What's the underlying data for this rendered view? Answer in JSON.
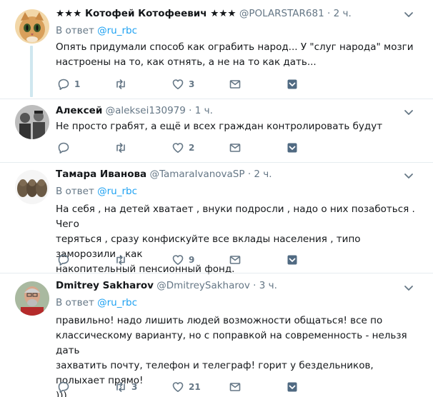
{
  "tweets": [
    {
      "name": "★★★ Котофей Котофеевич ★★★",
      "handle": "@POLARSTAR681",
      "time": "· 2 ч.",
      "reply_label": "В ответ",
      "reply_handle": "@ru_rbc",
      "text": "Опять придумали способ как ограбить народ... У \"слуг народа\" мозги\nнастроены на то, как отнять, а не на то как дать...",
      "replies": "1",
      "retweets": "",
      "likes": "3"
    },
    {
      "name": "Алексей",
      "handle": "@aleksei130979",
      "time": "· 1 ч.",
      "reply_label": "",
      "reply_handle": "",
      "text": "Не просто грабят, а ещё и всех граждан контролировать будут",
      "replies": "",
      "retweets": "",
      "likes": "2"
    },
    {
      "name": "Тамара Иванова",
      "handle": "@TamaraIvanovaSP",
      "time": "· 2 ч.",
      "reply_label": "В ответ",
      "reply_handle": "@ru_rbc",
      "text": "На себя , на детей хватает , внуки подросли , надо о них позаботься .  Чего\nтеряться , сразу конфискуйте все вклады населения , типо заморозили , как\nнакопительный пенсионный фонд.",
      "replies": "",
      "retweets": "",
      "likes": "9"
    },
    {
      "name": "Dmitrey Sakharov",
      "handle": "@DmitreySakharov",
      "time": "· 3 ч.",
      "reply_label": "В ответ",
      "reply_handle": "@ru_rbc",
      "text": "правильно! надо лишить людей возможности общаться! все по\nклассическому варианту, но с поправкой на современность - нельзя дать\nзахватить почту, телефон и телеграф! горит у бездельников, полыхает прямо!\n)))",
      "replies": "",
      "retweets": "3",
      "likes": "21"
    }
  ],
  "colors": {
    "text": "#14171a",
    "muted": "#657786",
    "link": "#1da1f2",
    "divider": "#e6ecf0",
    "thread": "#cfe7ef",
    "icon": "#657786",
    "dm_icon": "#506a82"
  },
  "icons": {
    "reply": "reply-icon",
    "retweet": "retweet-icon",
    "like": "heart-icon",
    "mail": "mail-icon",
    "save": "save-icon",
    "caret": "chevron-down-icon"
  }
}
